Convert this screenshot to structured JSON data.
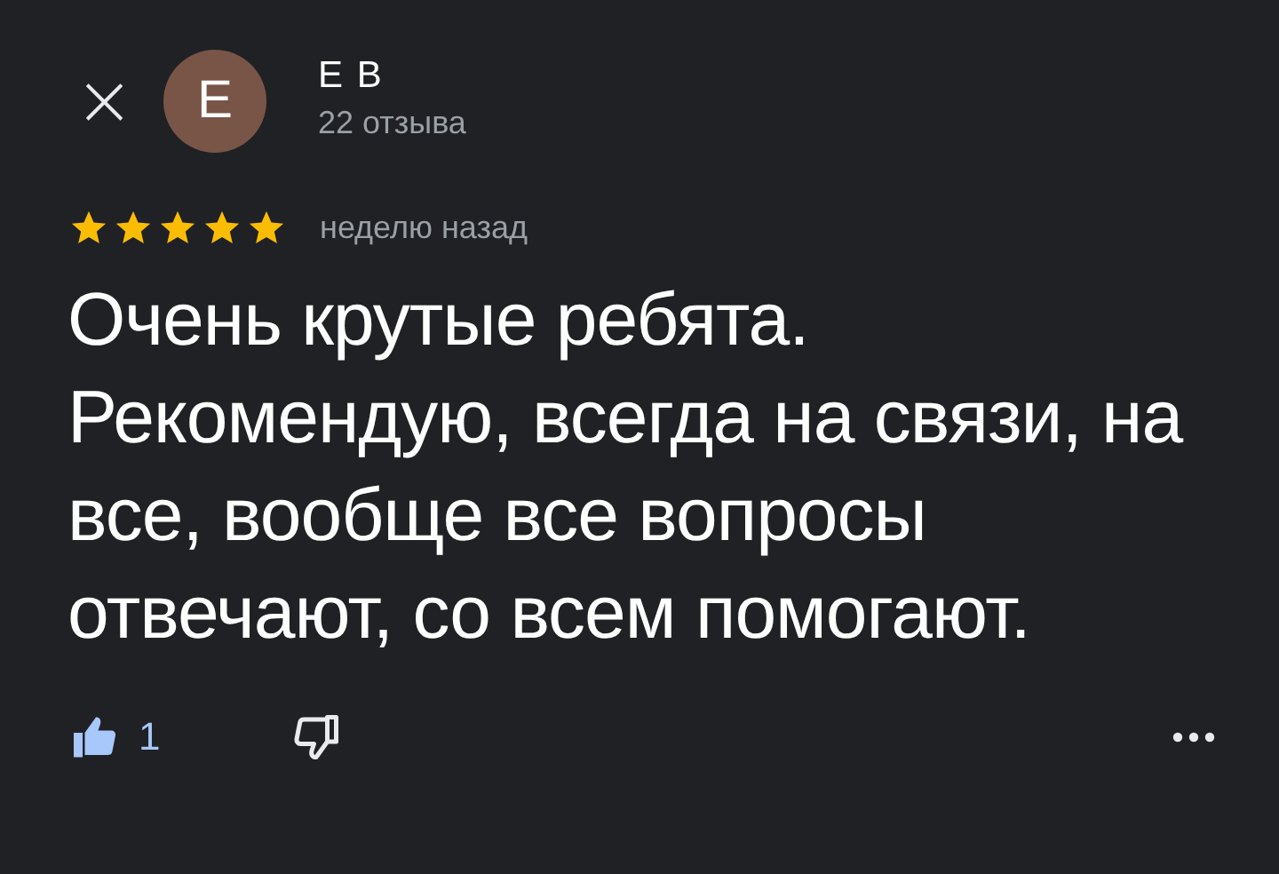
{
  "header": {
    "close": "×",
    "avatar_letter": "E",
    "name": "E B",
    "review_count": "22 отзыва"
  },
  "review": {
    "stars": 5,
    "time": "неделю назад",
    "text": "Очень крутые ребята. Рекомендую, всегда на связи, на все, вообще все вопросы отвечают, со всем помогают."
  },
  "actions": {
    "like": {
      "selected": true,
      "count": "1"
    },
    "dislike": {
      "selected": false
    }
  }
}
